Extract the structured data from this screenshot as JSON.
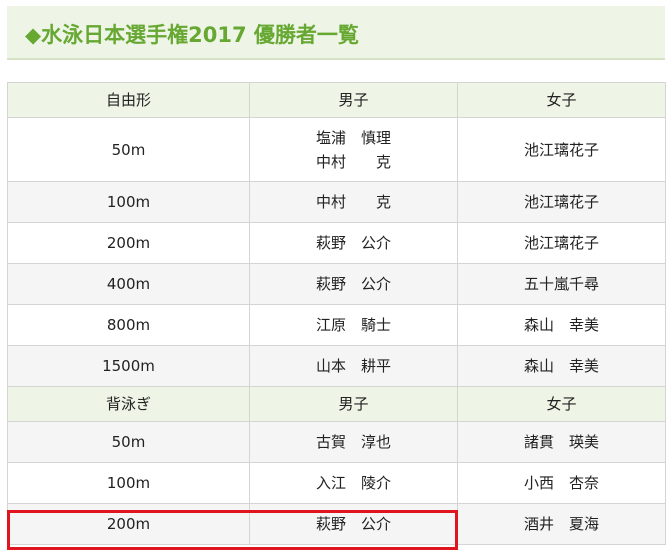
{
  "title": "◆水泳日本選手権2017 優勝者一覧",
  "sections": [
    {
      "header": [
        "自由形",
        "男子",
        "女子"
      ],
      "rows": [
        {
          "event": "50m",
          "men": "塩浦　慎理\n中村　　克",
          "women": "池江璃花子"
        },
        {
          "event": "100m",
          "men": "中村　　克",
          "women": "池江璃花子"
        },
        {
          "event": "200m",
          "men": "萩野　公介",
          "women": "池江璃花子"
        },
        {
          "event": "400m",
          "men": "萩野　公介",
          "women": "五十嵐千尋"
        },
        {
          "event": "800m",
          "men": "江原　騎士",
          "women": "森山　幸美"
        },
        {
          "event": "1500m",
          "men": "山本　耕平",
          "women": "森山　幸美"
        }
      ]
    },
    {
      "header": [
        "背泳ぎ",
        "男子",
        "女子"
      ],
      "rows": [
        {
          "event": "50m",
          "men": "古賀　淳也",
          "women": "諸貫　瑛美"
        },
        {
          "event": "100m",
          "men": "入江　陵介",
          "women": "小西　杏奈"
        },
        {
          "event": "200m",
          "men": "萩野　公介",
          "women": "酒井　夏海"
        }
      ]
    }
  ],
  "colors": {
    "title_text": "#66a832",
    "header_bg": "#eef4e6",
    "alt_row_bg": "#f5f5f5",
    "highlight_border": "#e0141e"
  }
}
